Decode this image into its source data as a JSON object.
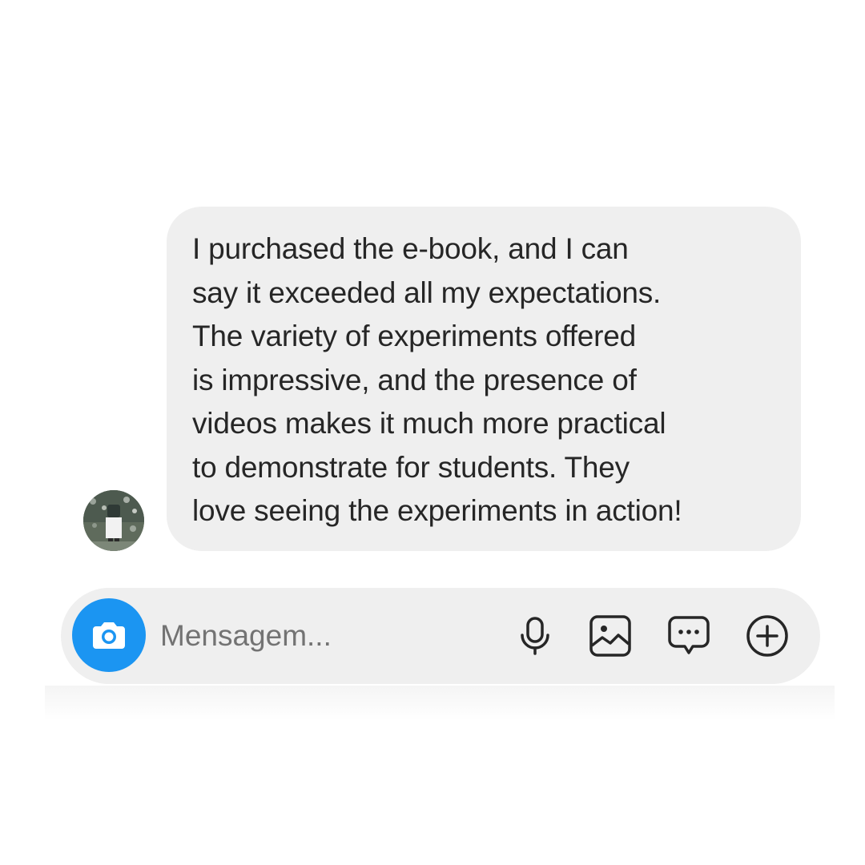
{
  "message": {
    "text": "I purchased the e-book, and I can\nsay it exceeded all my expectations.\nThe variety of experiments offered\nis impressive, and the presence of\nvideos makes it much more practical\nto demonstrate for students. They\nlove seeing the experiments in action!"
  },
  "composer": {
    "placeholder": "Mensagem..."
  },
  "icons": {
    "camera": "camera-icon",
    "microphone": "microphone-icon",
    "gallery": "gallery-icon",
    "sticker": "chat-bubble-icon",
    "add": "add-circle-icon"
  },
  "colors": {
    "accent": "#1b95f2",
    "bubble": "#efefef",
    "text": "#262626",
    "placeholder": "#737373"
  }
}
